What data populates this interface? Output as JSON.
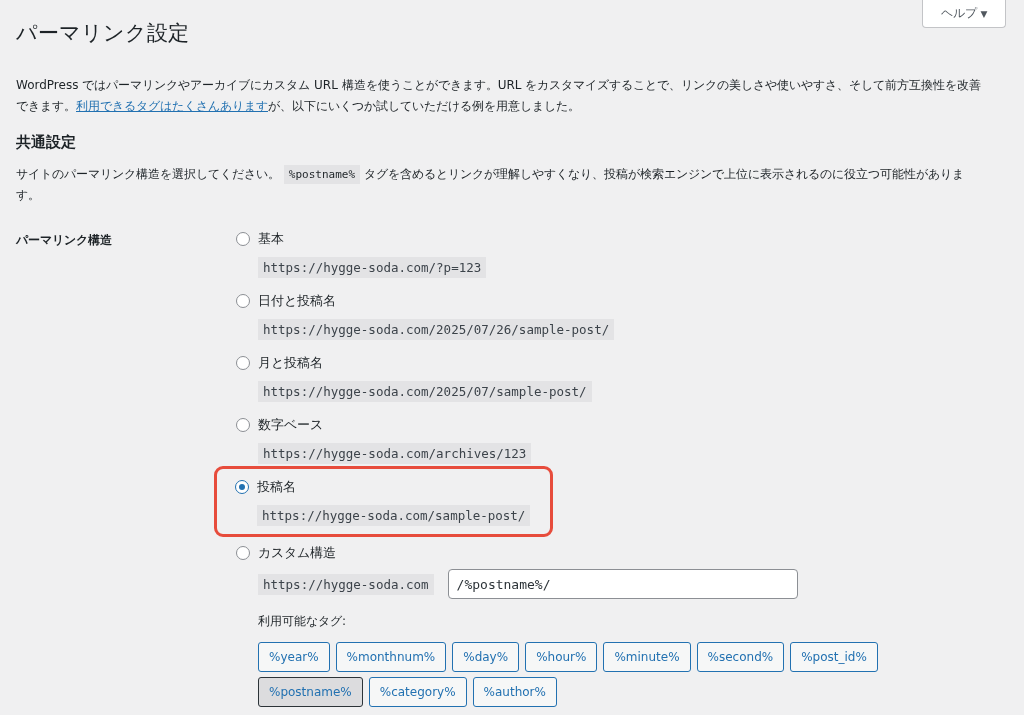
{
  "help_button": {
    "label": "ヘルプ",
    "caret": "▼"
  },
  "title": "パーマリンク設定",
  "intro": {
    "before": "WordPress ではパーマリンクやアーカイブにカスタム URL 構造を使うことができます。URL をカスタマイズすることで、リンクの美しさや使いやすさ、そして前方互換性を改善できます。",
    "link": "利用できるタグはたくさんあります",
    "after": "が、以下にいくつか試していただける例を用意しました。"
  },
  "section_title": "共通設定",
  "description": {
    "before": "サイトのパーマリンク構造を選択してください。",
    "code": "%postname%",
    "after": "タグを含めるとリンクが理解しやすくなり、投稿が検索エンジンで上位に表示されるのに役立つ可能性があります。"
  },
  "field_label": "パーマリンク構造",
  "options": [
    {
      "label": "基本",
      "example": "https://hygge-soda.com/?p=123",
      "selected": false,
      "highlighted": false
    },
    {
      "label": "日付と投稿名",
      "example": "https://hygge-soda.com/2025/07/26/sample-post/",
      "selected": false,
      "highlighted": false
    },
    {
      "label": "月と投稿名",
      "example": "https://hygge-soda.com/2025/07/sample-post/",
      "selected": false,
      "highlighted": false
    },
    {
      "label": "数字ベース",
      "example": "https://hygge-soda.com/archives/123",
      "selected": false,
      "highlighted": false
    },
    {
      "label": "投稿名",
      "example": "https://hygge-soda.com/sample-post/",
      "selected": true,
      "highlighted": true
    }
  ],
  "custom": {
    "label": "カスタム構造",
    "selected": false,
    "base": "https://hygge-soda.com",
    "value": "/%postname%/",
    "tags_label": "利用可能なタグ:",
    "tags": [
      {
        "label": "%year%",
        "selected": false
      },
      {
        "label": "%monthnum%",
        "selected": false
      },
      {
        "label": "%day%",
        "selected": false
      },
      {
        "label": "%hour%",
        "selected": false
      },
      {
        "label": "%minute%",
        "selected": false
      },
      {
        "label": "%second%",
        "selected": false
      },
      {
        "label": "%post_id%",
        "selected": false
      },
      {
        "label": "%postname%",
        "selected": true
      },
      {
        "label": "%category%",
        "selected": false
      },
      {
        "label": "%author%",
        "selected": false
      }
    ]
  }
}
